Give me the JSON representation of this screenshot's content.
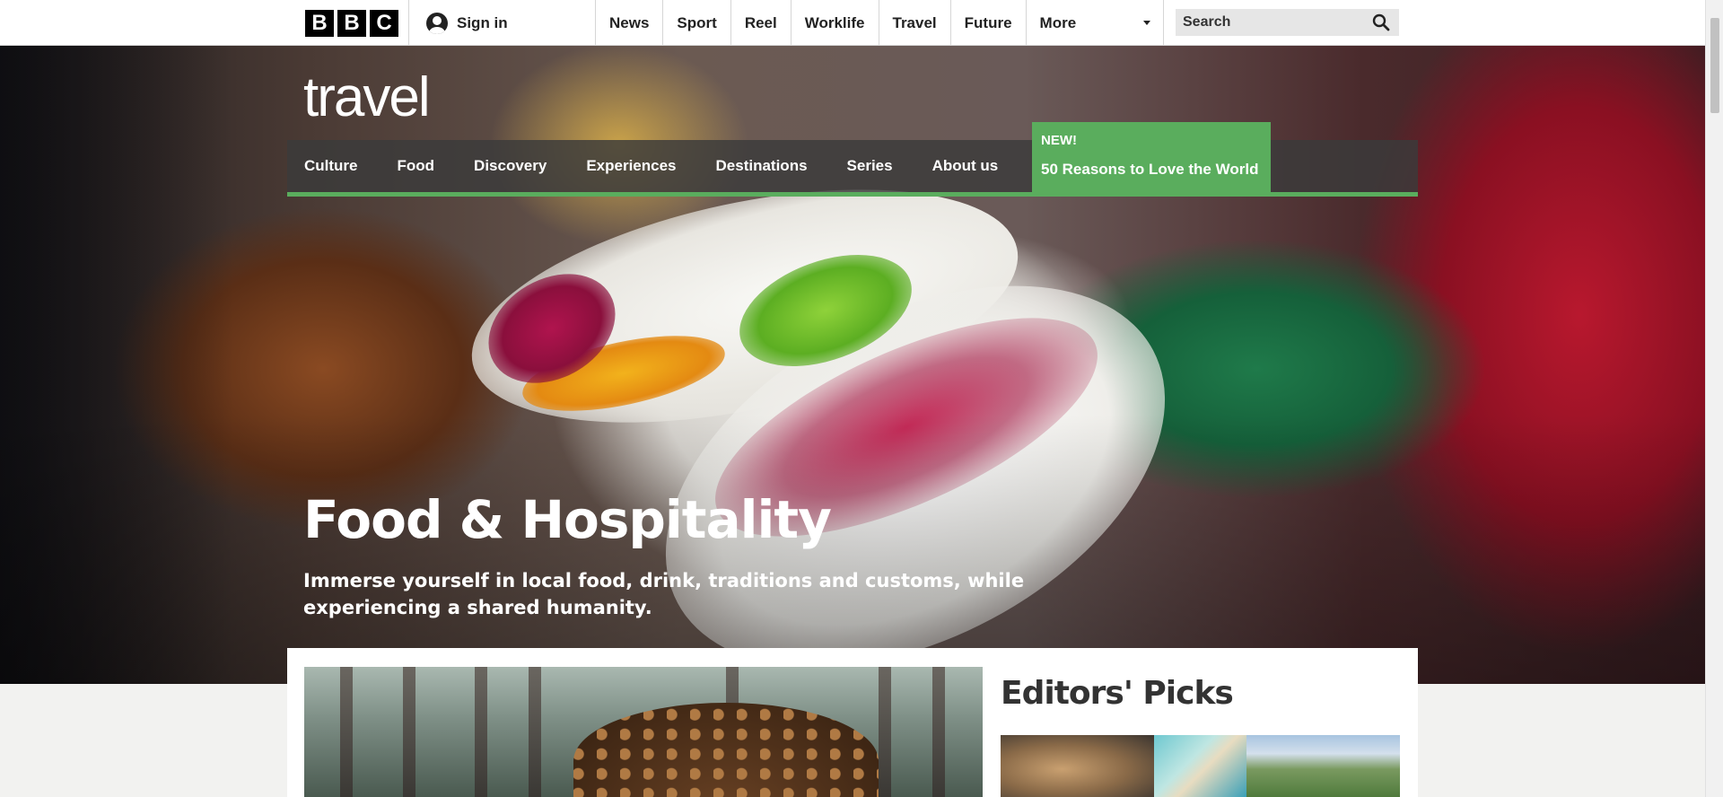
{
  "header": {
    "logo_letters": [
      "B",
      "B",
      "C"
    ],
    "sign_in_label": "Sign in",
    "nav_items": [
      "News",
      "Sport",
      "Reel",
      "Worklife",
      "Travel",
      "Future"
    ],
    "more_label": "More",
    "search_placeholder": "Search"
  },
  "travel": {
    "logo_text": "travel",
    "nav_items": [
      "Culture",
      "Food",
      "Discovery",
      "Experiences",
      "Destinations",
      "Series",
      "About us"
    ],
    "promo_label": "NEW!",
    "promo_text": "50 Reasons to Love the World",
    "accent_color": "#5aad5d"
  },
  "hero": {
    "title": "Food & Hospitality",
    "subtitle": "Immerse yourself in local food, drink, traditions and customs, while experiencing a shared humanity."
  },
  "editors_picks": {
    "title": "Editors' Picks"
  },
  "icons": {
    "user": "user-avatar-icon",
    "search": "magnifier-icon",
    "more": "caret-down-icon"
  }
}
